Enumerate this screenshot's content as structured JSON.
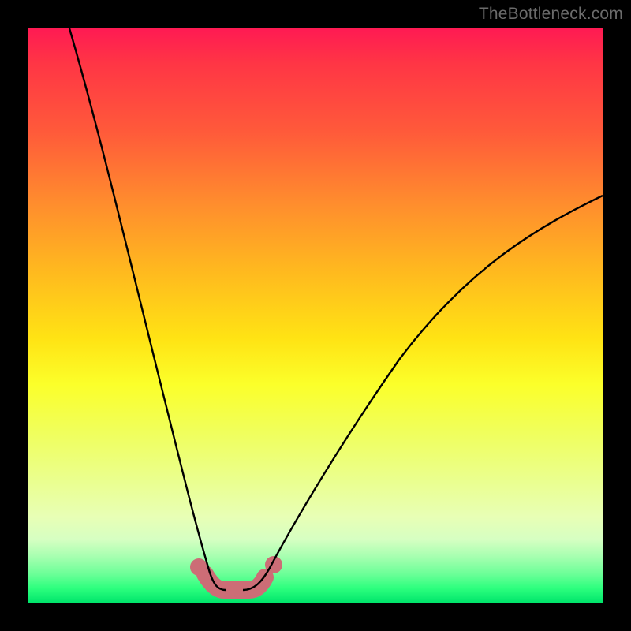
{
  "watermark": "TheBottleneck.com",
  "chart_data": {
    "type": "line",
    "title": "",
    "xlabel": "",
    "ylabel": "",
    "xlim": [
      0,
      100
    ],
    "ylim": [
      0,
      100
    ],
    "series": [
      {
        "name": "curve-left",
        "x": [
          7,
          10,
          14,
          18,
          22,
          24,
          26,
          28,
          29,
          30,
          31,
          32
        ],
        "y": [
          100,
          80,
          58,
          40,
          24,
          16,
          10,
          6,
          4,
          3,
          2.5,
          2
        ]
      },
      {
        "name": "curve-right",
        "x": [
          41,
          43,
          46,
          50,
          55,
          62,
          70,
          80,
          90,
          100
        ],
        "y": [
          2,
          4,
          8,
          14,
          22,
          32,
          42,
          52,
          60,
          67
        ]
      },
      {
        "name": "bottom-segment",
        "x": [
          30,
          31,
          32,
          33,
          33.5,
          34,
          35,
          36,
          37,
          38,
          39,
          40,
          40.5,
          41
        ],
        "y": [
          4.5,
          3.5,
          2,
          2,
          2.5,
          2,
          2,
          2,
          2,
          2.5,
          3.5,
          4,
          5,
          6
        ]
      }
    ],
    "bottom_segment_style": {
      "stroke": "#cc6d76",
      "stroke_width": 20,
      "dotted_ends": true
    },
    "curve_style": {
      "stroke": "#000000",
      "stroke_width": 2
    }
  }
}
